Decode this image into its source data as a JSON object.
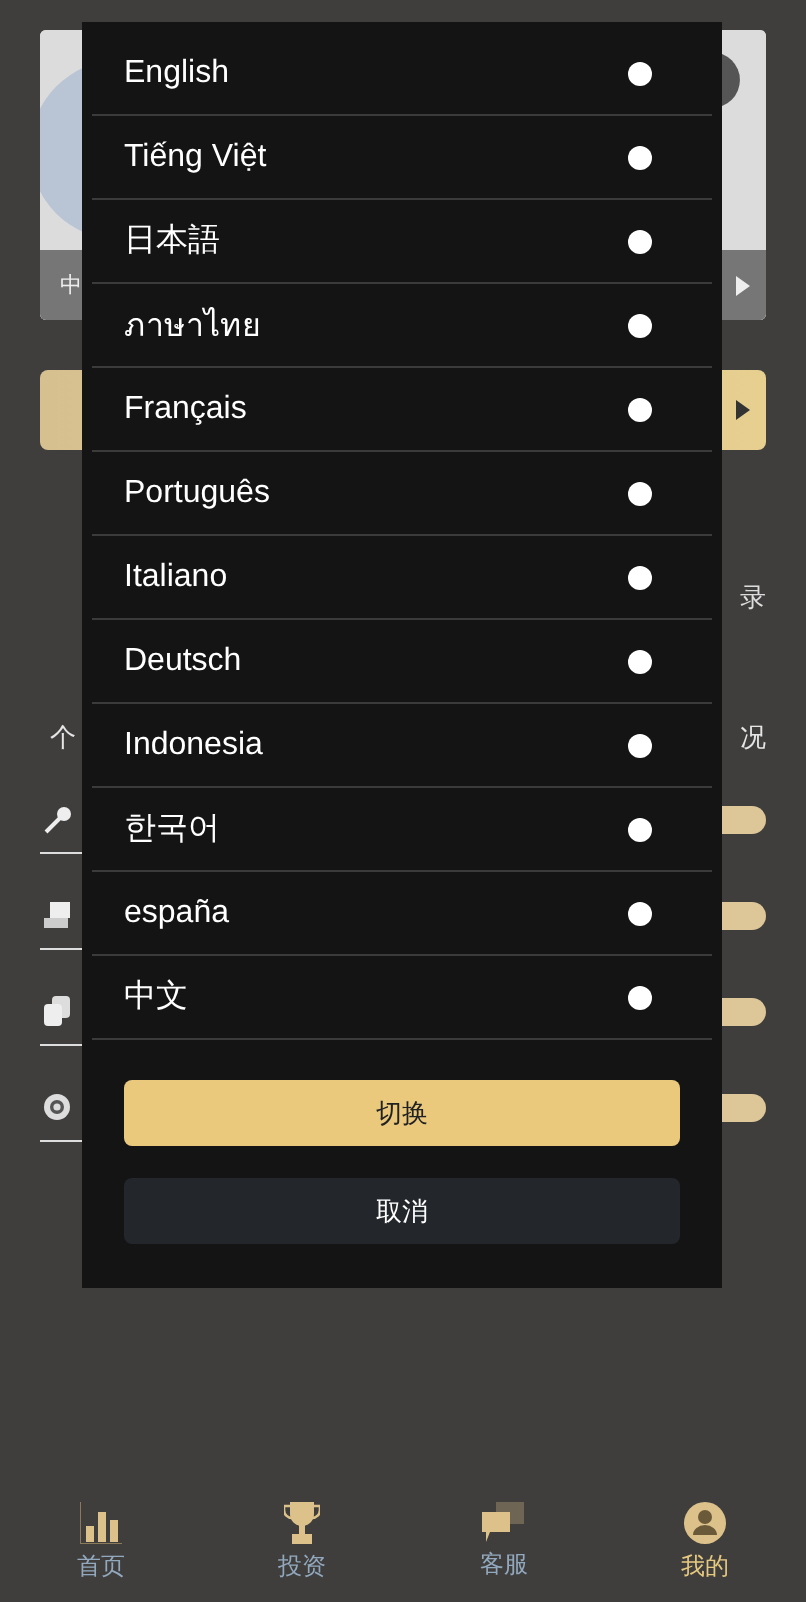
{
  "background": {
    "banner": {
      "caption": "中"
    },
    "shortcut_label": "录",
    "section_left": "个",
    "section_right": "况"
  },
  "language_dialog": {
    "languages": [
      {
        "label": "English",
        "selected": false
      },
      {
        "label": "Tiếng Việt",
        "selected": false
      },
      {
        "label": "日本語",
        "selected": false
      },
      {
        "label": "ภาษาไทย",
        "selected": false
      },
      {
        "label": "Français",
        "selected": false
      },
      {
        "label": "Português",
        "selected": false
      },
      {
        "label": "Italiano",
        "selected": false
      },
      {
        "label": "Deutsch",
        "selected": false
      },
      {
        "label": "Indonesia",
        "selected": false
      },
      {
        "label": "한국어",
        "selected": false
      },
      {
        "label": "españa",
        "selected": false
      },
      {
        "label": "中文",
        "selected": false
      }
    ],
    "confirm": "切换",
    "cancel": "取消"
  },
  "tab_bar": [
    {
      "label": "首页",
      "selected": false
    },
    {
      "label": "投资",
      "selected": false
    },
    {
      "label": "客服",
      "selected": false
    },
    {
      "label": "我的",
      "selected": true
    }
  ]
}
